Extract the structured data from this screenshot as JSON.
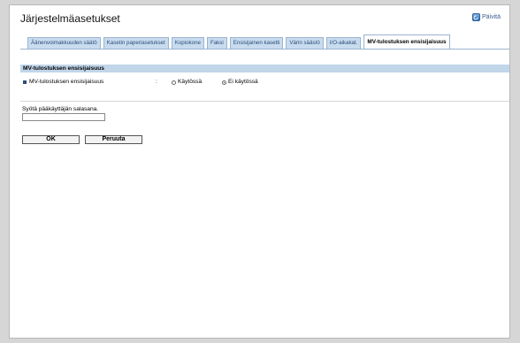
{
  "header": {
    "title": "Järjestelmäasetukset",
    "refresh_label": "Päivitä"
  },
  "tabs": [
    {
      "label": "Äänenvoimakkuuden säätö",
      "active": false
    },
    {
      "label": "Kasetin paperiasetukset",
      "active": false
    },
    {
      "label": "Kopiokone",
      "active": false
    },
    {
      "label": "Faksi",
      "active": false
    },
    {
      "label": "Ensisijainen kasetti",
      "active": false
    },
    {
      "label": "Värin säästö",
      "active": false
    },
    {
      "label": "I/O-aikakat.",
      "active": false
    },
    {
      "label": "MV-tulostuksen ensisijaisuus",
      "active": true
    }
  ],
  "section": {
    "title": "MV-tulostuksen ensisijaisuus",
    "setting_label": "MV-tulostuksen ensisijaisuus",
    "colon": ":",
    "options": [
      {
        "label": "Käytössä",
        "checked": false
      },
      {
        "label": "Ei käytössä",
        "checked": true
      }
    ]
  },
  "password": {
    "label": "Syötä pääkäyttäjän salasana.",
    "value": ""
  },
  "buttons": {
    "ok_label": "OK",
    "cancel_label": "Peruuta"
  }
}
